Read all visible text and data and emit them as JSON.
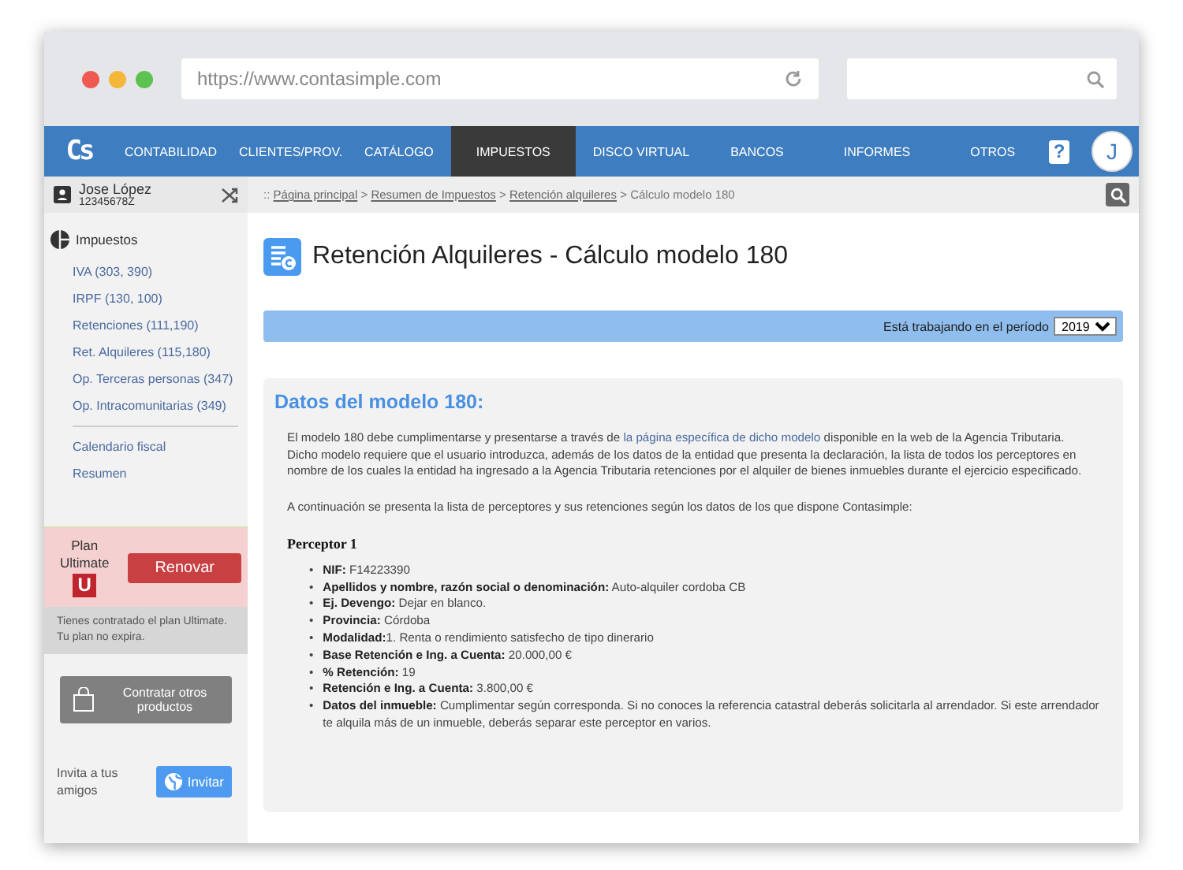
{
  "browser": {
    "url": "https://www.contasimple.com"
  },
  "nav": {
    "logo": "Cs",
    "items": [
      {
        "label": "CONTABILIDAD",
        "selected": false
      },
      {
        "label": "CLIENTES/PROV.",
        "selected": false
      },
      {
        "label": "CATÁLOGO",
        "selected": false
      },
      {
        "label": "IMPUESTOS",
        "selected": true
      },
      {
        "label": "DISCO VIRTUAL",
        "selected": false
      },
      {
        "label": "BANCOS",
        "selected": false
      },
      {
        "label": "INFORMES",
        "selected": false
      },
      {
        "label": "OTROS",
        "selected": false
      }
    ],
    "help": "?",
    "avatar": "J"
  },
  "user": {
    "name": "Jose López",
    "id": "12345678Z"
  },
  "sidebar": {
    "section": "Impuestos",
    "items": [
      {
        "label": "IVA (303, 390)"
      },
      {
        "label": "IRPF (130, 100)"
      },
      {
        "label": "Retenciones (111,190)"
      },
      {
        "label": "Ret. Alquileres (115,180)"
      },
      {
        "label": "Op. Terceras personas (347)"
      },
      {
        "label": "Op. Intracomunitarias (349)"
      }
    ],
    "extra_items": [
      {
        "label": "Calendario fiscal"
      },
      {
        "label": "Resumen"
      }
    ]
  },
  "plan": {
    "label": "Plan",
    "name": "Ultimate",
    "badge": "U",
    "renew": "Renovar",
    "note": "Tienes contratado el plan Ultimate. Tu plan no expira."
  },
  "contract_button": "Contratar otros productos",
  "invite": {
    "text": "Invita a tus amigos",
    "button": "Invitar"
  },
  "breadcrumb": {
    "prefix": "::",
    "separator": ">",
    "items": [
      {
        "label": "Página principal",
        "link": true
      },
      {
        "label": "Resumen de Impuestos",
        "link": true
      },
      {
        "label": "Retención alquileres",
        "link": true
      },
      {
        "label": "Cálculo modelo 180",
        "link": false
      }
    ]
  },
  "page_title": "Retención Alquileres - Cálculo modelo 180",
  "period": {
    "label": "Está trabajando en el período",
    "value": "2019"
  },
  "card": {
    "title": "Datos del modelo 180:",
    "intro": {
      "before": "El modelo 180 debe cumplimentarse y presentarse a través de",
      "link": "la página específica de dicho modelo",
      "after": "disponible en la web de la Agencia Tributaria. Dicho modelo requiere que el usuario introduzca, además de los datos de la entidad que presenta la declaración, la lista de todos los perceptores en nombre de los cuales la entidad ha ingresado a la Agencia Tributaria retenciones por el alquiler de bienes inmuebles durante el ejercicio especificado."
    },
    "lead": "A continuación se presenta la lista de perceptores y sus retenciones según los datos de los que dispone Contasimple:",
    "perceptor_title": "Perceptor 1",
    "bullet": "•",
    "fields": [
      "**NIF:** F14223390",
      "**Apellidos y nombre, razón social o denominación:** Auto-alquiler cordoba CB",
      "**Ej. Devengo:** Dejar en blanco.",
      "**Provincia:** Córdoba",
      "**Modalidad:**1. Renta o rendimiento satisfecho de tipo dinerario",
      "**Base Retención e Ing. a Cuenta:** 20.000,00 €",
      "**% Retención:** 19",
      "**Retención e Ing. a Cuenta:** 3.800,00 €",
      "**Datos del inmueble:** Cumplimentar según corresponda. Si no conoces la referencia catastral deberás solicitarla al arrendador. Si este arrendador te alquila más de un inmueble, deberás separar este perceptor en varios."
    ]
  }
}
